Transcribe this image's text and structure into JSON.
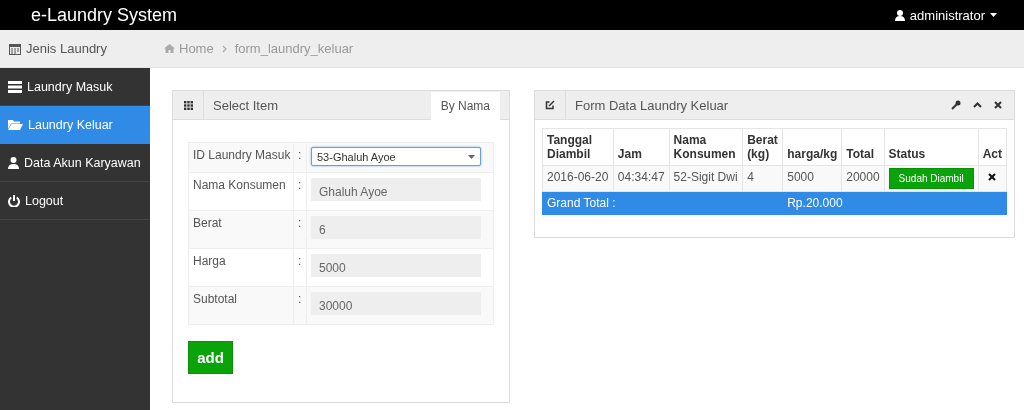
{
  "app": {
    "title": "e-Laundry System",
    "user": "administrator"
  },
  "sidebar_header": {
    "label": "Jenis Laundry"
  },
  "breadcrumb": [
    "Home",
    "form_laundry_keluar"
  ],
  "sidebar": {
    "items": [
      {
        "label": "Laundry Masuk",
        "selected": false
      },
      {
        "label": "Laundry Keluar",
        "selected": true
      },
      {
        "label": "Data Akun Karyawan",
        "selected": false
      },
      {
        "label": "Logout",
        "selected": false
      }
    ]
  },
  "select_panel": {
    "title": "Select Item",
    "tab": {
      "label": "By Nama",
      "selected": true
    },
    "fields": [
      {
        "label": "ID Laundry Masuk",
        "separator": ":",
        "value": "53-Ghaluh Ayoe",
        "kind": "select"
      },
      {
        "label": "Nama Konsumen",
        "separator": ":",
        "value": "Ghaluh Ayoe",
        "kind": "readonly"
      },
      {
        "label": "Berat",
        "separator": ":",
        "value": "6",
        "kind": "readonly"
      },
      {
        "label": "Harga",
        "separator": ":",
        "value": "5000",
        "kind": "readonly"
      },
      {
        "label": "Subtotal",
        "separator": ":",
        "value": "30000",
        "kind": "readonly"
      }
    ],
    "button": "add"
  },
  "data_panel": {
    "title": "Form Data Laundry Keluar",
    "table": {
      "columns": [
        "Tanggal Diambil",
        "Jam",
        "Nama Konsumen",
        "Berat (kg)",
        "harga/kg",
        "Total",
        "Status",
        "Act"
      ],
      "rows": [
        {
          "cells": [
            "2016-06-20",
            "04:34:47",
            "52-Sigit Dwi",
            "4",
            "5000",
            "20000"
          ],
          "status": "Sudah Diambil"
        }
      ],
      "grand_total": {
        "label": "Grand Total :",
        "value": "Rp.20.000"
      }
    }
  }
}
